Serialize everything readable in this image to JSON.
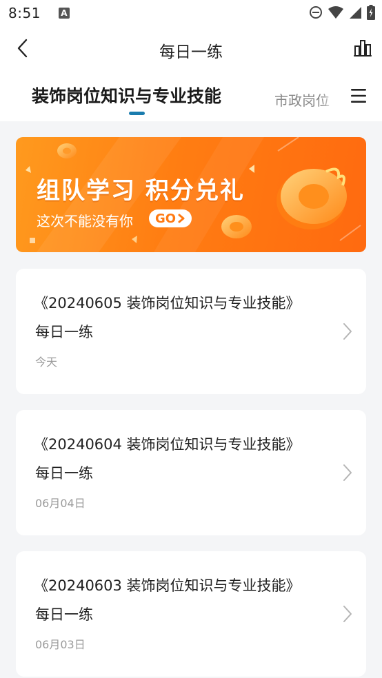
{
  "status_bar": {
    "time": "8:51",
    "notification_icon": "a-icon",
    "right_icons": [
      "do-not-disturb-icon",
      "wifi-icon",
      "signal-icon",
      "battery-icon"
    ]
  },
  "header": {
    "title": "每日一练",
    "back_icon": "chevron-left-icon",
    "stats_icon": "bar-chart-icon"
  },
  "tabs": {
    "active_label": "装饰岗位知识与专业技能",
    "next_label": "市政岗位",
    "menu_icon": "hamburger-menu-icon",
    "indicator_color": "#1a7cae"
  },
  "banner": {
    "title": "组队学习 积分兑礼",
    "subtitle": "这次不能没有你",
    "go_label": "GO",
    "accent_color": "#ff7d12"
  },
  "cards": [
    {
      "title": "《20240605 装饰岗位知识与专业技能》",
      "subtitle": "每日一练",
      "date": "今天"
    },
    {
      "title": "《20240604 装饰岗位知识与专业技能》",
      "subtitle": "每日一练",
      "date": "06月04日"
    },
    {
      "title": "《20240603 装饰岗位知识与专业技能》",
      "subtitle": "每日一练",
      "date": "06月03日"
    }
  ]
}
